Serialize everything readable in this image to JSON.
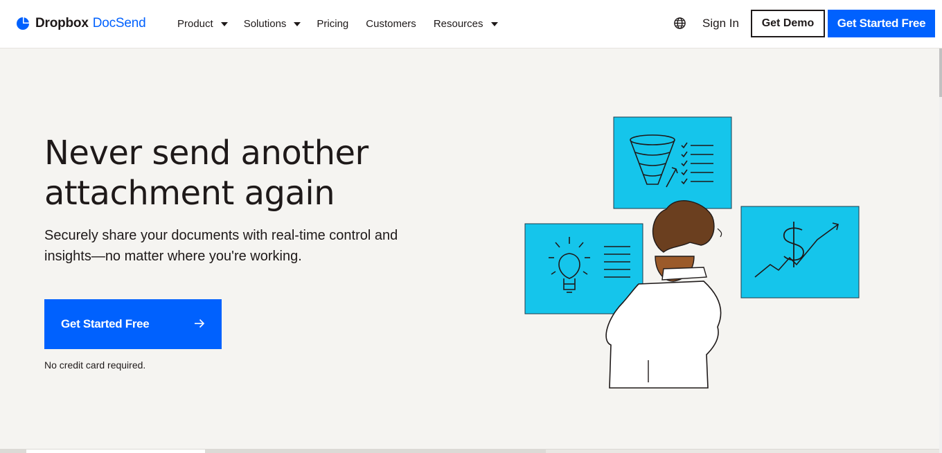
{
  "brand": {
    "name_bold": "Dropbox",
    "name_light": "DocSend",
    "accent_color": "#0061fe",
    "text_color": "#1e1919",
    "hero_background": "#f5f4f1",
    "illustration_panel_color": "#15c5eb"
  },
  "nav": {
    "items": [
      {
        "label": "Product",
        "has_dropdown": true
      },
      {
        "label": "Solutions",
        "has_dropdown": true
      },
      {
        "label": "Pricing",
        "has_dropdown": false
      },
      {
        "label": "Customers",
        "has_dropdown": false
      },
      {
        "label": "Resources",
        "has_dropdown": true
      }
    ],
    "language_icon": "globe-icon",
    "sign_in": "Sign In",
    "get_demo": "Get Demo",
    "get_started": "Get Started Free"
  },
  "hero": {
    "headline_lines": [
      "Never send another",
      "attachment again"
    ],
    "subtext_lines": [
      "Securely share your documents with real-time control and",
      "insights—no matter where you're working."
    ],
    "cta_label": "Get Started Free",
    "cta_icon": "arrow-right-icon",
    "note": "No credit card required."
  },
  "illustration": {
    "panels": [
      "funnel-checklist-panel",
      "lightbulb-panel",
      "dollar-growth-panel"
    ],
    "figure": "person-viewing-panels"
  }
}
